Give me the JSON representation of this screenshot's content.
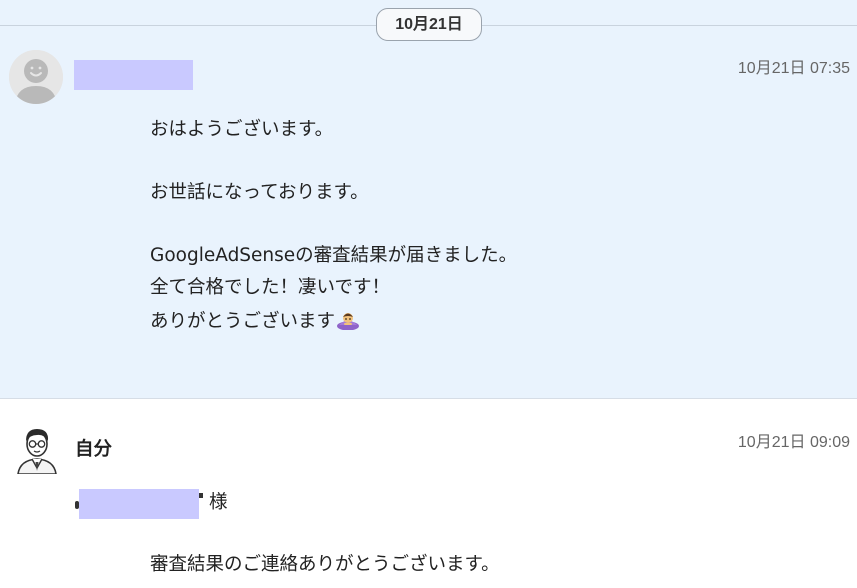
{
  "date_separator": "10月21日",
  "messages": [
    {
      "sender_type": "other",
      "timestamp": "10月21日 07:35",
      "lines": [
        "おはようございます。",
        "お世話になっております。",
        "GoogleAdSenseの審査結果が届きました。",
        "全て合格でした！凄いです！",
        "ありがとうございます"
      ],
      "trailing_emoji": "person-bowing-icon"
    },
    {
      "sender_type": "self",
      "sender_name": "自分",
      "timestamp": "10月21日 09:09",
      "honorific": "様",
      "lines": [
        "審査結果のご連絡ありがとうございます。"
      ]
    }
  ],
  "colors": {
    "other_bg": "#e9f3fd",
    "self_bg": "#ffffff",
    "redaction": "#c9c9ff"
  }
}
